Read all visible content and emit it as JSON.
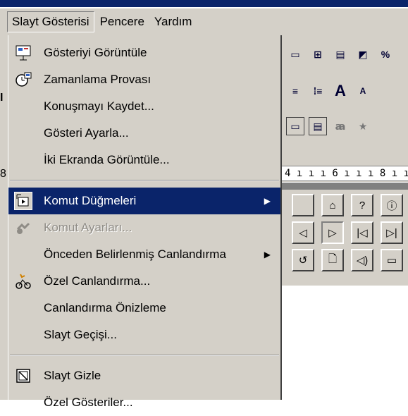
{
  "menubar": {
    "items": [
      {
        "label": "Slayt Gösterisi",
        "active": true
      },
      {
        "label": "Pencere",
        "active": false
      },
      {
        "label": "Yardım",
        "active": false
      }
    ]
  },
  "menu": {
    "group1": [
      {
        "label": "Gösteriyi Görüntüle",
        "icon": "slideshow-icon"
      },
      {
        "label": "Zamanlama Provası",
        "icon": "rehearse-timing-icon"
      },
      {
        "label": "Konuşmayı Kaydet...",
        "icon": ""
      },
      {
        "label": "Gösteri Ayarla...",
        "icon": ""
      },
      {
        "label": "İki Ekranda Görüntüle...",
        "icon": ""
      }
    ],
    "group2": [
      {
        "label": "Komut Düğmeleri",
        "icon": "action-buttons-icon",
        "submenu": true,
        "highlight": true
      },
      {
        "label": "Komut Ayarları...",
        "icon": "action-settings-icon",
        "disabled": true
      },
      {
        "label": "Önceden Belirlenmiş Canlandırma",
        "icon": "",
        "submenu": true
      },
      {
        "label": "Özel Canlandırma...",
        "icon": "custom-animation-icon"
      },
      {
        "label": "Canlandırma Önizleme",
        "icon": ""
      },
      {
        "label": "Slayt Geçişi...",
        "icon": ""
      }
    ],
    "group3": [
      {
        "label": "Slayt Gizle",
        "icon": "hide-slide-icon"
      },
      {
        "label": "Özel Gösteriler...",
        "icon": ""
      }
    ]
  },
  "ruler_text": "4 ı ı ı 6 ı ı ı 8 ı ı",
  "toolbar": {
    "row1": [
      "▭",
      "⊞",
      "▤",
      "◩",
      "%"
    ],
    "row2": [
      "≡",
      "⁞≡",
      "A",
      "A"
    ],
    "row3": [
      "▭",
      "▤",
      "ꜳ",
      "★"
    ]
  },
  "palette": [
    {
      "glyph": "",
      "name": "custom-action-icon"
    },
    {
      "glyph": "⌂",
      "name": "home-icon"
    },
    {
      "glyph": "?",
      "name": "help-icon"
    },
    {
      "glyph": "ⓘ",
      "name": "information-icon"
    },
    {
      "glyph": "◁",
      "name": "back-icon"
    },
    {
      "glyph": "▷",
      "name": "forward-icon",
      "pressed": true
    },
    {
      "glyph": "|◁",
      "name": "beginning-icon"
    },
    {
      "glyph": "▷|",
      "name": "end-icon"
    },
    {
      "glyph": "↺",
      "name": "return-icon"
    },
    {
      "glyph": "🗋",
      "name": "document-icon"
    },
    {
      "glyph": "◁)",
      "name": "sound-icon"
    },
    {
      "glyph": "▭",
      "name": "movie-icon"
    }
  ],
  "colors": {
    "menu_bg": "#d4d0c8",
    "highlight": "#0a246a",
    "disabled": "#8f8c86"
  }
}
